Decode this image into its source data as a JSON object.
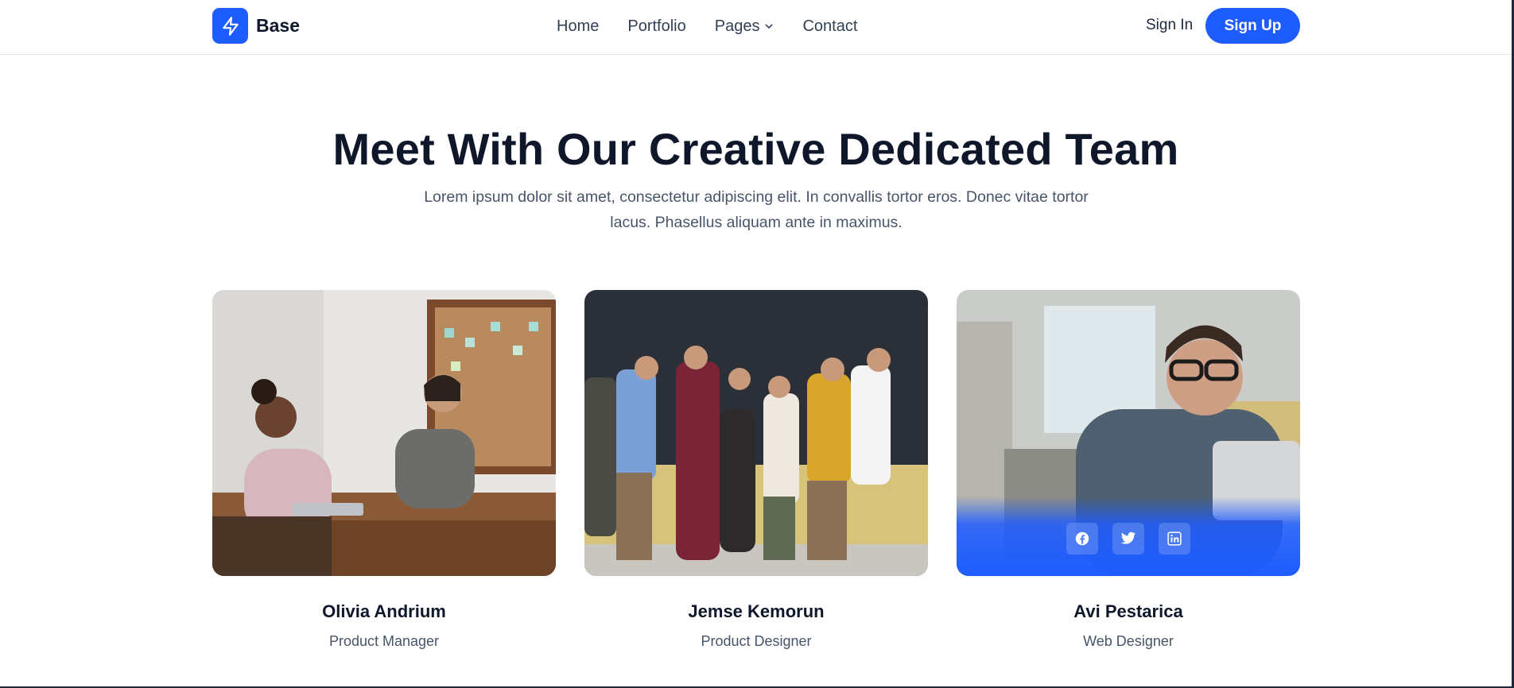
{
  "brand": {
    "name": "Base",
    "icon": "bolt-icon",
    "color": "#1d5cff"
  },
  "nav": {
    "items": [
      {
        "label": "Home"
      },
      {
        "label": "Portfolio"
      },
      {
        "label": "Pages",
        "icon": "chevron-down-icon"
      },
      {
        "label": "Contact"
      }
    ],
    "signin_label": "Sign In",
    "signup_label": "Sign Up"
  },
  "hero": {
    "title": "Meet With Our Creative Dedicated Team",
    "subtitle": "Lorem ipsum dolor sit amet, consectetur adipiscing elit. In convallis tortor eros. Donec vitae tortor lacus. Phasellus aliquam ante in maximus."
  },
  "team": [
    {
      "name": "Olivia Andrium",
      "role": "Product Manager"
    },
    {
      "name": "Jemse Kemorun",
      "role": "Product Designer"
    },
    {
      "name": "Avi Pestarica",
      "role": "Web Designer",
      "socials": [
        "facebook-icon",
        "twitter-icon",
        "linkedin-icon"
      ]
    }
  ]
}
